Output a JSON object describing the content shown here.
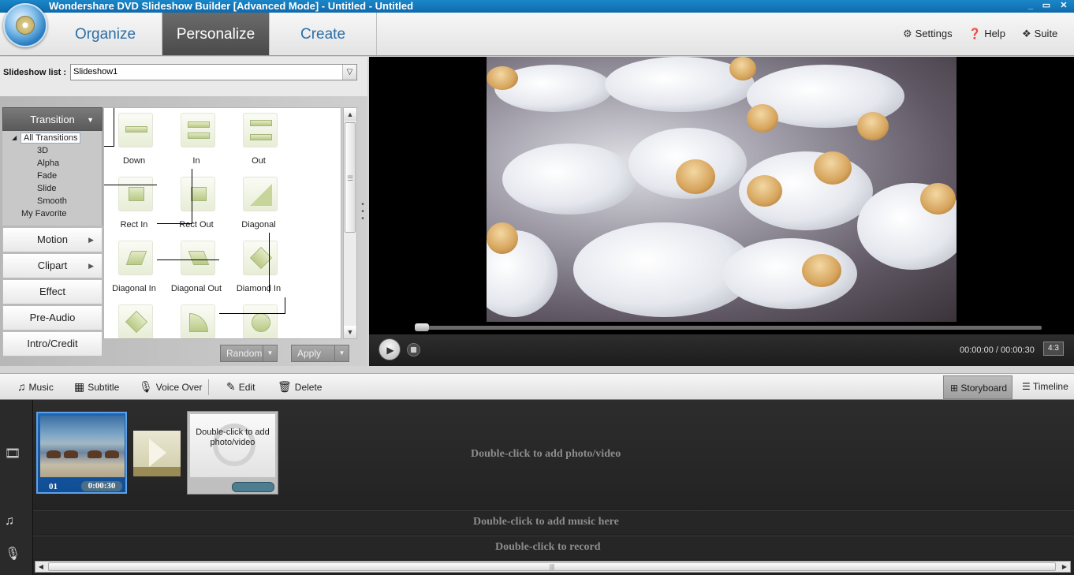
{
  "window": {
    "title": "Wondershare DVD Slideshow Builder [Advanced Mode] - Untitled - Untitled",
    "minimize": "_",
    "maximize": "▭",
    "close": "✕"
  },
  "nav": {
    "tabs": [
      {
        "label": "Organize",
        "active": false
      },
      {
        "label": "Personalize",
        "active": true
      },
      {
        "label": "Create",
        "active": false
      }
    ],
    "settings": "Settings",
    "help": "Help",
    "suite": "Suite"
  },
  "slideshow_list": {
    "label": "Slideshow list :",
    "value": "Slideshow1"
  },
  "categories": {
    "transition": "Transition",
    "motion": "Motion",
    "clipart": "Clipart",
    "effect": "Effect",
    "pre_audio": "Pre-Audio",
    "intro_credit": "Intro/Credit"
  },
  "tree": {
    "all": "All Transitions",
    "items": [
      "3D",
      "Alpha",
      "Fade",
      "Slide",
      "Smooth"
    ],
    "favorite": "My Favorite"
  },
  "transitions": [
    "Down",
    "In",
    "Out",
    "Rect In",
    "Rect Out",
    "Diagonal",
    "Diagonal In",
    "Diagonal Out",
    "Diamond In",
    "",
    "",
    ""
  ],
  "gallery_buttons": {
    "random": "Random",
    "apply": "Apply"
  },
  "preview": {
    "time": "00:00:00 / 00:00:30",
    "aspect": "4:3",
    "progress": 0
  },
  "storyboard_toolbar": {
    "music": "Music",
    "subtitle": "Subtitle",
    "voice_over": "Voice Over",
    "edit": "Edit",
    "delete": "Delete",
    "storyboard": "Storyboard",
    "timeline": "Timeline"
  },
  "storyboard": {
    "clip": {
      "number": "01",
      "duration": "0:00:30"
    },
    "add_slot_text": "Double-click to add photo/video",
    "hint_video": "Double-click to add photo/video",
    "hint_music": "Double-click to add music here",
    "hint_record": "Double-click to record"
  },
  "colors": {
    "titlebar": "#1a87c9",
    "active_tab": "#5a5a5a",
    "nav_text": "#2a6fa8",
    "selected_clip": "#1b66b9"
  }
}
